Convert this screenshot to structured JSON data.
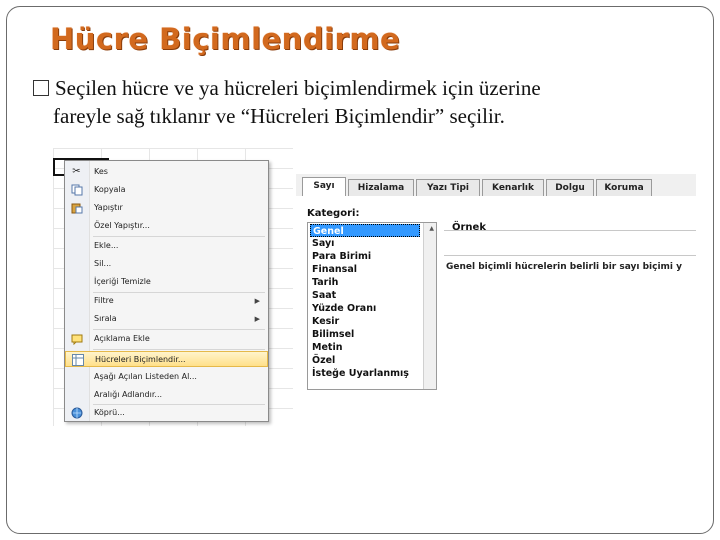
{
  "slide": {
    "title": "Hücre Biçimlendirme",
    "bullet_line1": "Seçilen hücre ve ya hücreleri biçimlendirmek için üzerine",
    "bullet_line2": "fareyle sağ tıklanır ve “Hücreleri Biçimlendir” seçilir.",
    "title_color": "#d2691e"
  },
  "context_menu": {
    "items": [
      {
        "label": "Kes",
        "icon": "scissors-icon"
      },
      {
        "label": "Kopyala",
        "icon": "copy-icon"
      },
      {
        "label": "Yapıştır",
        "icon": "paste-icon"
      },
      {
        "label": "Özel Yapıştır..."
      },
      {
        "label": "Ekle..."
      },
      {
        "label": "Sil..."
      },
      {
        "label": "İçeriği Temizle"
      },
      {
        "label": "Filtre",
        "submenu": true
      },
      {
        "label": "Sırala",
        "submenu": true
      },
      {
        "label": "Açıklama Ekle",
        "icon": "comment-icon"
      },
      {
        "label": "Hücreleri Biçimlendir...",
        "icon": "format-cells-icon",
        "highlighted": true
      },
      {
        "label": "Aşağı Açılan Listeden Al..."
      },
      {
        "label": "Aralığı Adlandır..."
      },
      {
        "label": "Köprü...",
        "icon": "hyperlink-icon"
      }
    ],
    "highlight_color": "#ffe08a"
  },
  "dialog": {
    "tabs": [
      "Sayı",
      "Hizalama",
      "Yazı Tipi",
      "Kenarlık",
      "Dolgu",
      "Koruma"
    ],
    "active_tab": "Sayı",
    "category_label": "Kategori:",
    "categories": [
      "Genel",
      "Sayı",
      "Para Birimi",
      "Finansal",
      "Tarih",
      "Saat",
      "Yüzde Oranı",
      "Kesir",
      "Bilimsel",
      "Metin",
      "Özel",
      "İsteğe Uyarlanmış"
    ],
    "selected_category": "Genel",
    "sample_label": "Örnek",
    "description": "Genel biçimli hücrelerin belirli bir sayı biçimi y",
    "selection_color": "#3399ff"
  }
}
